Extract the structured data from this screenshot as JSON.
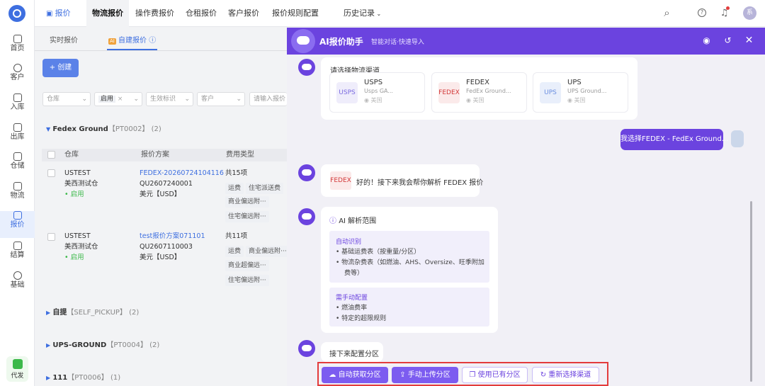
{
  "sidebar": {
    "items": [
      {
        "label": "首页"
      },
      {
        "label": "客户"
      },
      {
        "label": "入库"
      },
      {
        "label": "出库"
      },
      {
        "label": "仓储"
      },
      {
        "label": "物流"
      },
      {
        "label": "报价"
      },
      {
        "label": "结算"
      },
      {
        "label": "基础"
      }
    ],
    "bottom_label": "代发"
  },
  "topbar": {
    "tabs": [
      "报价",
      "物流报价",
      "操作费报价",
      "仓租报价",
      "客户报价",
      "报价规则配置",
      "历史记录"
    ],
    "avatar": "系"
  },
  "main": {
    "subtabs": [
      "实时报价",
      "自建报价"
    ],
    "ai_badge": "AI",
    "create_label": "+ 创建",
    "filters": [
      "仓库",
      "启用",
      "生效标识",
      "客户",
      "请输入报价"
    ],
    "groups": [
      {
        "name": "Fedex Ground",
        "code": "【PT0002】",
        "count": "(2)"
      },
      {
        "name": "自提",
        "code": "【SELF_PICKUP】",
        "count": "(2)"
      },
      {
        "name": "UPS-GROUND",
        "code": "【PT0004】",
        "count": "(2)"
      },
      {
        "name": "111",
        "code": "【PT0006】",
        "count": "(1)"
      }
    ],
    "table_headers": [
      "仓库",
      "报价方案",
      "费用类型"
    ],
    "rows": [
      {
        "warehouse": "USTEST",
        "warehouse_sub": "美西测试仓",
        "status": "• 启用",
        "plan": "FEDEX-20260724104116",
        "plan_code": "QU2607240001",
        "currency": "美元【USD】",
        "fee_count": "共15项",
        "fees": [
          "运费",
          "住宅派送费",
          "商业偏远附···",
          "住宅偏远附···"
        ]
      },
      {
        "warehouse": "USTEST",
        "warehouse_sub": "美西测试仓",
        "status": "• 启用",
        "plan": "test报价方案071101",
        "plan_code": "QU2607110003",
        "currency": "美元【USD】",
        "fee_count": "共11项",
        "fees": [
          "运费",
          "商业偏远附···",
          "商业超偏远···",
          "住宅偏远附···"
        ]
      }
    ]
  },
  "panel": {
    "title": "AI报价助手",
    "subtitle": "智能对话·快速导入",
    "choose_channel": "请选择物流渠道",
    "channels": [
      {
        "logo": "USPS",
        "name": "USPS",
        "desc": "Usps GA...",
        "region": "美国",
        "color": "#7b6be0",
        "bg": "#efedfb"
      },
      {
        "logo": "FEDEX",
        "name": "FEDEX",
        "desc": "FedEx Ground...",
        "region": "美国",
        "color": "#d33a3a",
        "bg": "#fbeaea"
      },
      {
        "logo": "UPS",
        "name": "UPS",
        "desc": "UPS Ground...",
        "region": "美国",
        "color": "#6b8fe0",
        "bg": "#e9effb"
      }
    ],
    "user_message": "我选择FEDEX - FedEx Ground...",
    "fedex_tag": "FEDEX",
    "reply": "好的！接下来我会帮你解析 FEDEX 报价",
    "scope_title": "AI 解析范围",
    "auto_title": "自动识别",
    "auto_items": [
      "• 基础运费表（按重量/分区）",
      "• 物流杂费表（如燃油、AHS、Oversize、旺季附加",
      "费等）"
    ],
    "manual_title": "需手动配置",
    "manual_items": [
      "• 燃油费率",
      "• 特定的超限规则"
    ],
    "next_text": "接下来配置分区",
    "actions": [
      "自动获取分区",
      "手动上传分区",
      "使用已有分区",
      "重新选择渠道"
    ]
  }
}
